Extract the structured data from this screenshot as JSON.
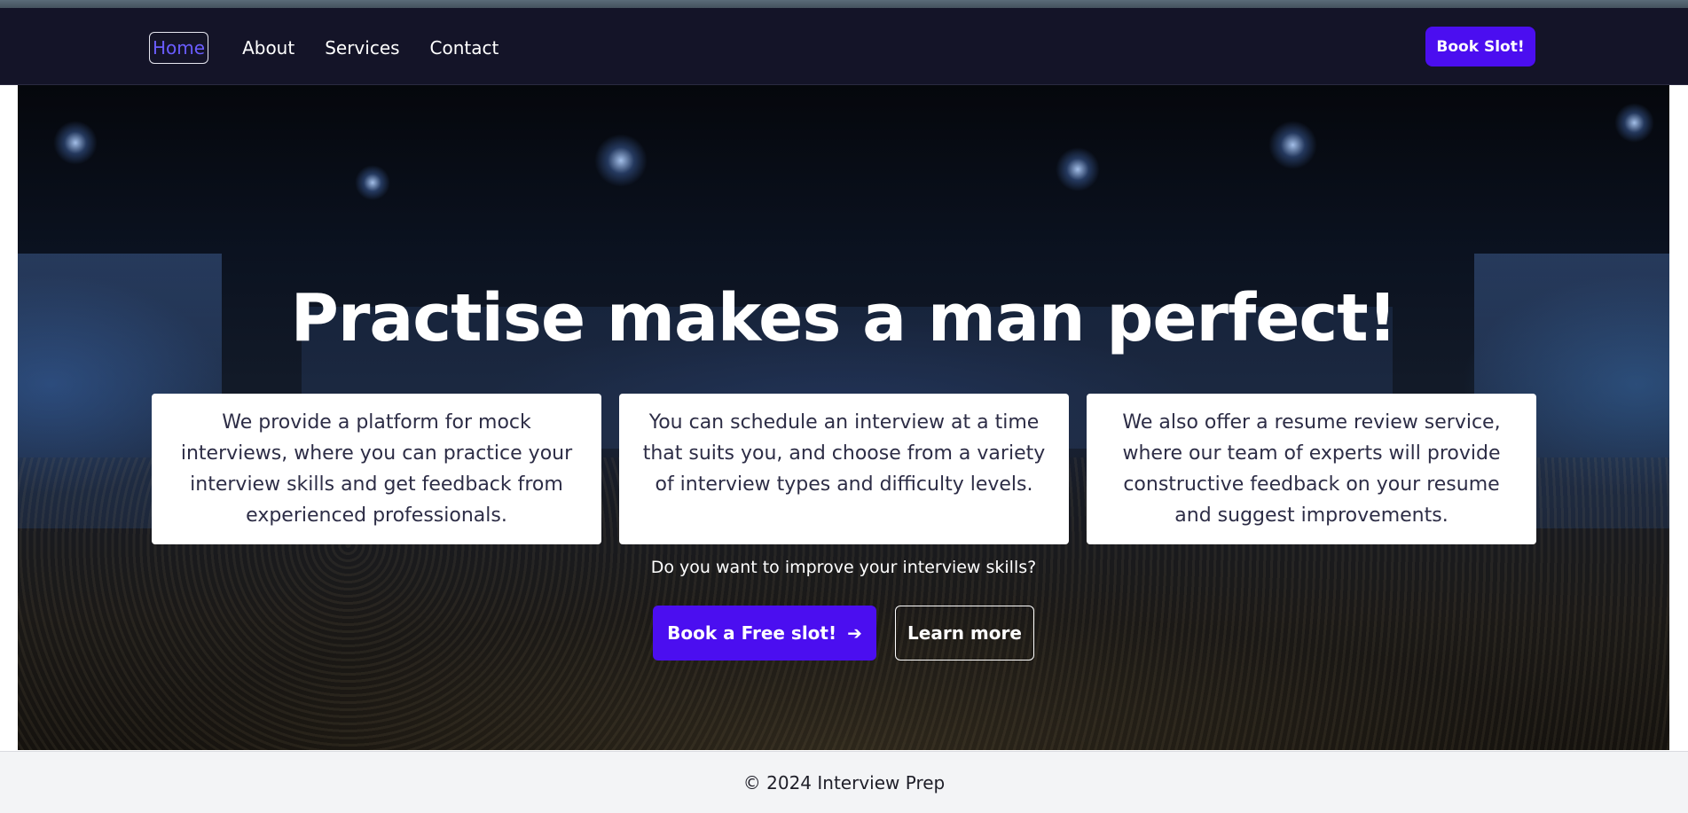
{
  "nav": {
    "links": [
      "Home",
      "About",
      "Services",
      "Contact"
    ],
    "active": "Home",
    "cta_label": "Book Slot!"
  },
  "hero": {
    "title": "Practise makes a man perfect!",
    "cards": [
      "We provide a platform for mock interviews, where you can practice your interview skills and get feedback from experienced professionals.",
      "You can schedule an interview at a time that suits you, and choose from a variety of interview types and difficulty levels.",
      "We also offer a resume review service, where our team of experts will provide constructive feedback on your resume and suggest improvements."
    ],
    "question": "Do you want to improve your interview skills?",
    "primary_cta": "Book a Free slot!",
    "primary_cta_icon": "arrow-right-icon",
    "secondary_cta": "Learn more"
  },
  "footer": {
    "text": "© 2024 Interview Prep"
  },
  "colors": {
    "nav_bg": "#141428",
    "accent": "#4b0ef0",
    "active_link": "#6a5cff",
    "footer_bg": "#f3f4f6"
  }
}
